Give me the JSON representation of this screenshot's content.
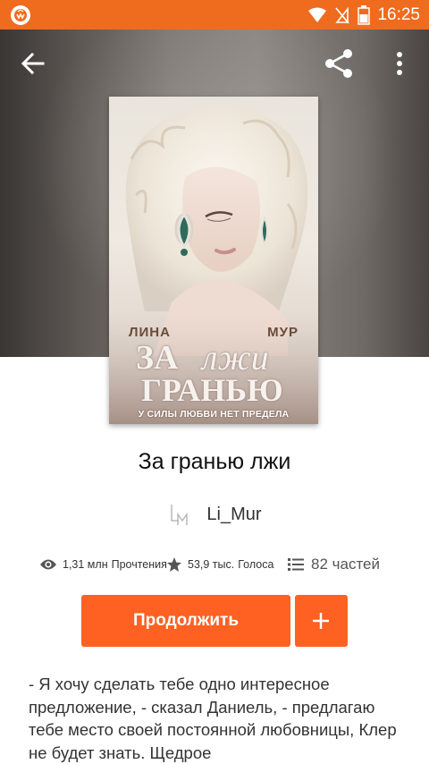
{
  "status_bar": {
    "time": "16:25",
    "icons": [
      "wattpad-app-icon",
      "wifi-icon",
      "no-signal-icon",
      "battery-icon"
    ]
  },
  "toolbar": {
    "back_icon": "arrow-left-icon",
    "share_icon": "share-icon",
    "more_icon": "more-vertical-icon"
  },
  "cover": {
    "author_first": "ЛИНА",
    "author_last": "МУР",
    "title_top": "ЗА",
    "title_script": "лжи",
    "title_bottom": "ГРАНЬЮ",
    "tagline": "У СИЛЫ ЛЮБВИ НЕТ ПРЕДЕЛА"
  },
  "story": {
    "title": "За гранью лжи",
    "author": "Li_Mur"
  },
  "stats": {
    "reads_value": "1,31 млн",
    "reads_label": "Прочтения",
    "votes_value": "53,9 тыс.",
    "votes_label": "Голоса",
    "parts": "82 частей"
  },
  "actions": {
    "continue_label": "Продолжить",
    "add_label": "+"
  },
  "description": "- Я хочу сделать тебе одно интересное предложение, - сказал Даниель, - предлагаю тебе место своей постоянной любовницы, Клер не будет знать. Щедрое",
  "colors": {
    "accent": "#ff6122",
    "status_bar": "#ef6c1f"
  }
}
